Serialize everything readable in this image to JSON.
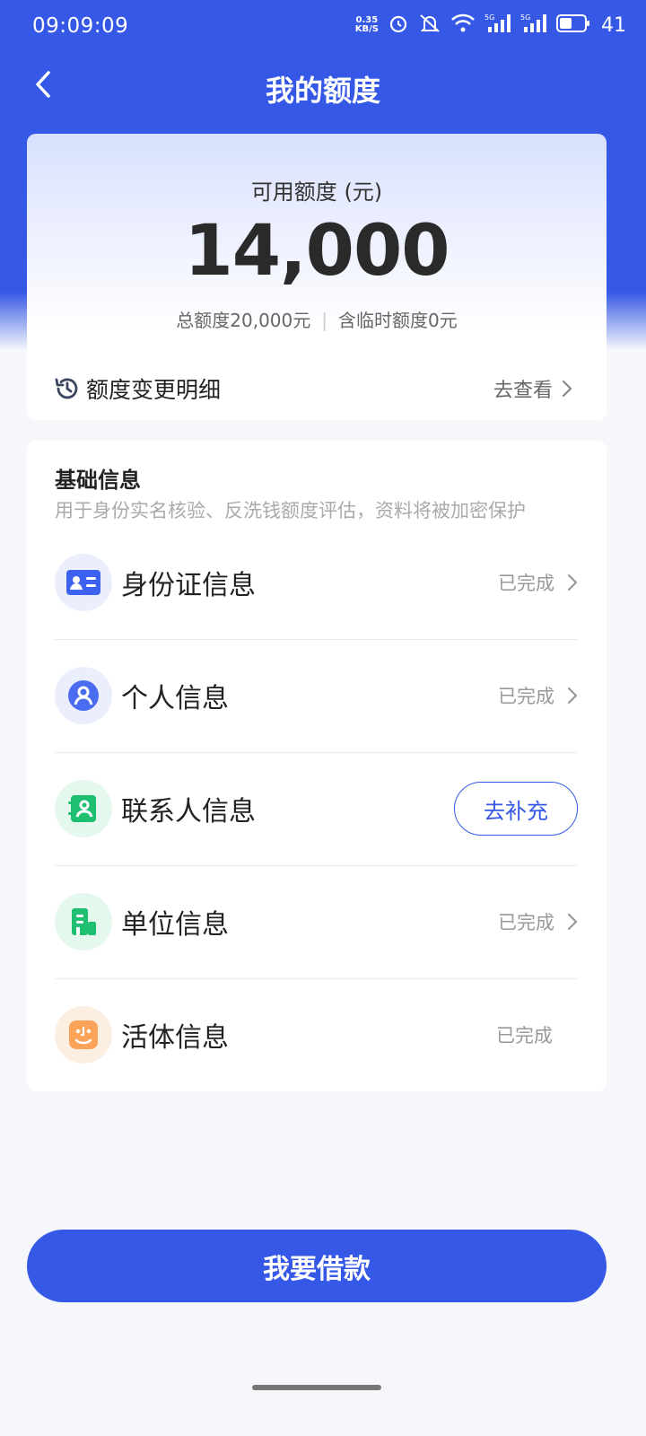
{
  "status_bar": {
    "time": "09:09:09",
    "net_speed_value": "0.35",
    "net_speed_unit": "KB/S",
    "battery": "41",
    "icons": [
      "alarm-icon",
      "mute-icon",
      "wifi-icon",
      "signal-5g-icon",
      "signal-5g-icon",
      "battery-icon"
    ]
  },
  "nav": {
    "title": "我的额度",
    "back_icon": "chevron-left-icon"
  },
  "quota": {
    "label": "可用额度 (元)",
    "amount": "14,000",
    "total": "总额度20,000元",
    "temporary": "含临时额度0元",
    "change_label": "额度变更明细",
    "change_action": "去查看"
  },
  "basic_info": {
    "title": "基础信息",
    "description": "用于身份实名核验、反洗钱额度评估，资料将被加密保护",
    "items": [
      {
        "label": "身份证信息",
        "status": "已完成"
      },
      {
        "label": "个人信息",
        "status": "已完成"
      },
      {
        "label": "联系人信息",
        "action": "去补充"
      },
      {
        "label": "单位信息",
        "status": "已完成"
      },
      {
        "label": "活体信息",
        "status": "已完成"
      }
    ]
  },
  "loan_button": "我要借款",
  "colors": {
    "primary": "#3558e6",
    "id_icon_bg": "#eaeefd",
    "contact_icon_bg": "#e5f8ee",
    "company_icon_bg": "#e5f8ee",
    "face_icon_bg": "#fdeee2"
  }
}
